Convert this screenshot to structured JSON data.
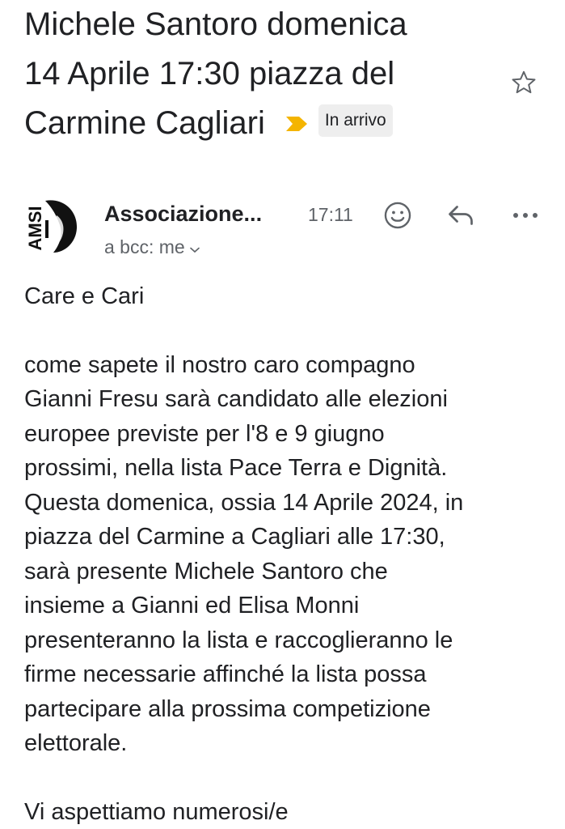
{
  "subject": {
    "lines": [
      "Michele Santoro domenica",
      "14 Aprile 17:30 piazza del",
      "Carmine Cagliari"
    ],
    "label": "In arrivo"
  },
  "header": {
    "sender": "Associazione...",
    "time": "17:11",
    "recipients": "a bcc: me",
    "avatar_text": "AMSI"
  },
  "icons": {
    "importance": "importance-marker-icon",
    "star": "star-icon",
    "emoji": "emoji-reaction-icon",
    "reply": "reply-icon",
    "more": "more-options-icon",
    "chevron": "chevron-down-icon"
  },
  "colors": {
    "importance": "#f4b400",
    "text": "#202124",
    "secondary": "#5f6368",
    "chip_bg": "#eeeeee"
  },
  "body": {
    "greeting": "Care e Cari",
    "paragraph_lines": [
      "come sapete il nostro caro compagno",
      "Gianni Fresu sarà candidato alle elezioni",
      "europee previste per l'8 e 9 giugno",
      "prossimi, nella lista Pace Terra e Dignità.",
      "Questa domenica, ossia 14 Aprile 2024, in",
      "piazza del Carmine a Cagliari alle 17:30,",
      "sarà presente Michele Santoro che",
      "insieme a Gianni ed Elisa Monni",
      "presenteranno la lista e raccoglieranno le",
      "firme necessarie affinché la lista possa",
      "partecipare alla prossima competizione",
      "elettorale."
    ],
    "closing": "Vi aspettiamo numerosi/e"
  }
}
